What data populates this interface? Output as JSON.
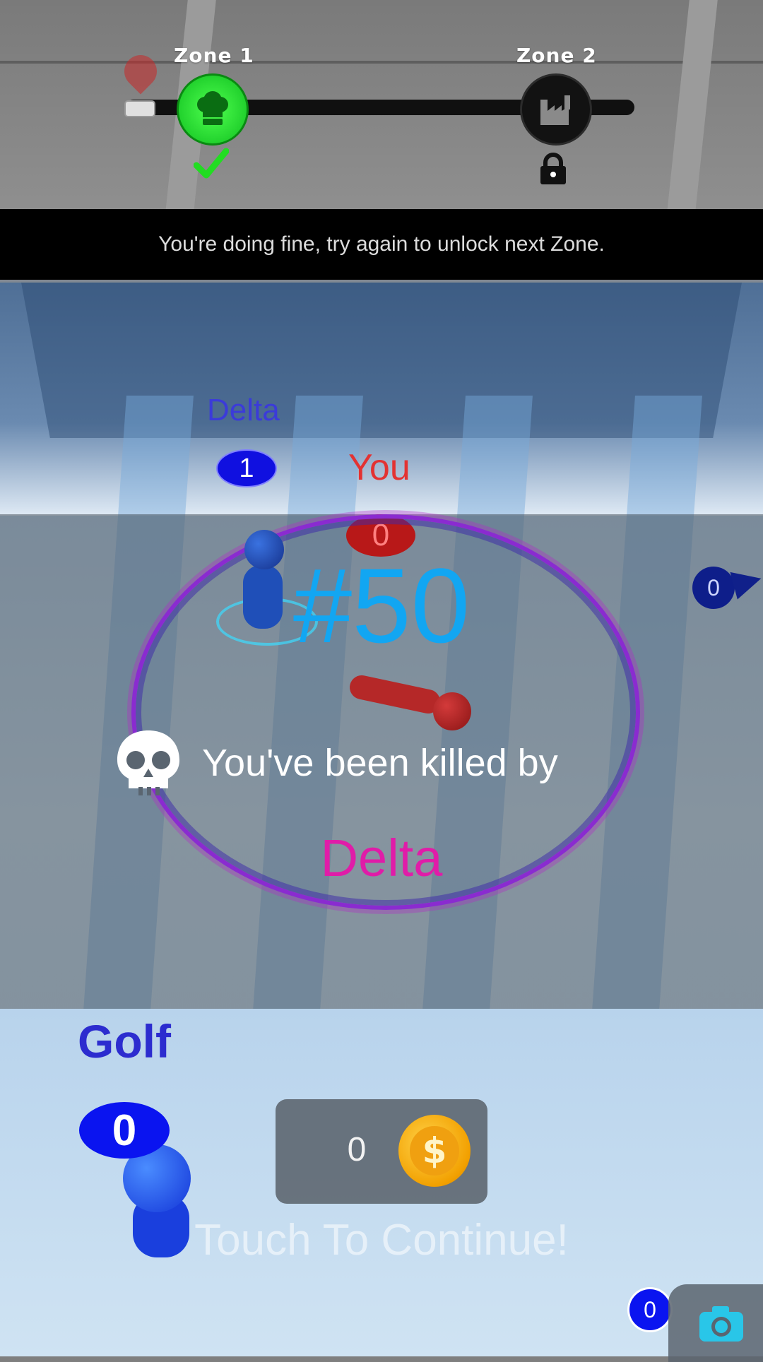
{
  "progress": {
    "zone1_label": "Zone 1",
    "zone2_label": "Zone 2",
    "zone1_status": "completed",
    "zone2_status": "locked",
    "icons": {
      "zone1": "chef-hat-icon",
      "zone2": "factory-icon",
      "completed": "checkmark-icon",
      "locked": "lock-icon",
      "position": "map-pin-icon"
    },
    "colors": {
      "zone1": "#22dd22",
      "zone2": "#121212",
      "check": "#22dd22"
    }
  },
  "hint": {
    "text": "You're doing fine, try again to unlock next Zone."
  },
  "players": {
    "delta_top": {
      "name": "Delta",
      "score": "1"
    },
    "you": {
      "name": "You",
      "score": "0"
    },
    "offscreen_right": {
      "score": "0"
    },
    "golf": {
      "name": "Golf",
      "score": "0"
    },
    "corner": {
      "score": "0"
    }
  },
  "result": {
    "rank": "#50",
    "killed_by_text": "You've been killed by",
    "killer_name": "Delta",
    "colors": {
      "rank": "#12a6f2",
      "killer": "#e01ca8"
    }
  },
  "coins": {
    "count": "0",
    "icon": "dollar-coin-icon",
    "symbol": "$"
  },
  "continue": {
    "text": "Touch To Continue!"
  },
  "camera": {
    "icon": "camera-icon"
  }
}
